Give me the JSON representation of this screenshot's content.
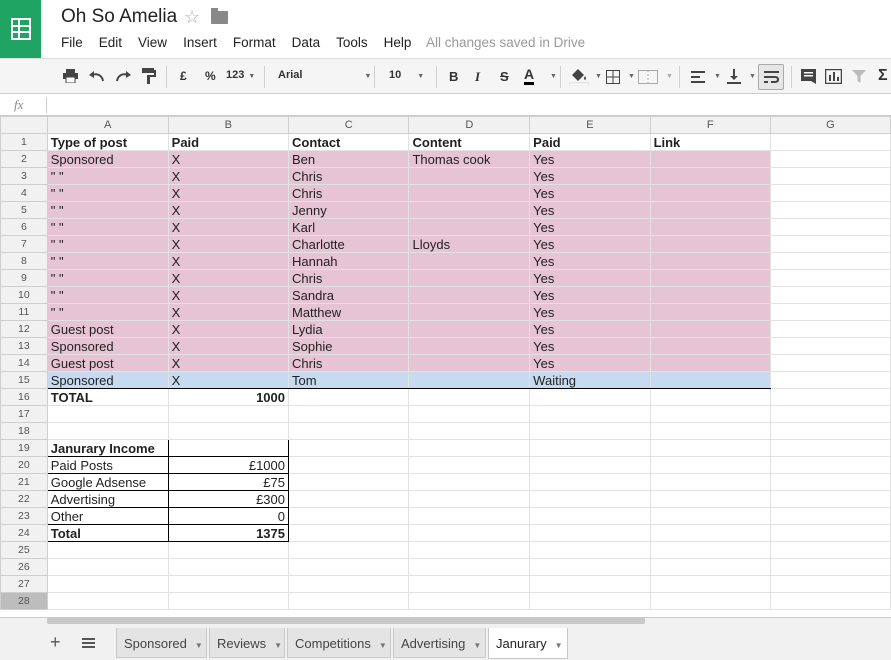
{
  "app": {
    "title": "Oh So Amelia",
    "saved_status": "All changes saved in Drive"
  },
  "menu": [
    "File",
    "Edit",
    "View",
    "Insert",
    "Format",
    "Data",
    "Tools",
    "Help"
  ],
  "toolbar": {
    "currency": "£",
    "percent": "%",
    "number_format": "123",
    "font": "Arial",
    "font_size": "10",
    "bold": "B",
    "italic": "I",
    "strike": "S",
    "text_color": "A"
  },
  "formula_bar": {
    "label": "fx",
    "value": ""
  },
  "columns": [
    "A",
    "B",
    "C",
    "D",
    "E",
    "F",
    "G"
  ],
  "rows": [
    {
      "n": "1",
      "cells": [
        "Type of post",
        "Paid",
        "Contact",
        "Content",
        "Paid",
        "Link"
      ],
      "style": "header"
    },
    {
      "n": "2",
      "cells": [
        "Sponsored",
        "X",
        "Ben",
        "Thomas cook",
        "Yes",
        ""
      ],
      "style": "pink"
    },
    {
      "n": "3",
      "cells": [
        "\" \"",
        "X",
        "Chris",
        "",
        "Yes",
        ""
      ],
      "style": "pink"
    },
    {
      "n": "4",
      "cells": [
        "\" \"",
        "X",
        "Chris",
        "",
        "Yes",
        ""
      ],
      "style": "pink"
    },
    {
      "n": "5",
      "cells": [
        "\" \"",
        "X",
        "Jenny",
        "",
        "Yes",
        ""
      ],
      "style": "pink"
    },
    {
      "n": "6",
      "cells": [
        "\" \"",
        "X",
        "Karl",
        "",
        "Yes",
        ""
      ],
      "style": "pink"
    },
    {
      "n": "7",
      "cells": [
        "\" \"",
        "X",
        "Charlotte",
        "Lloyds",
        "Yes",
        ""
      ],
      "style": "pink"
    },
    {
      "n": "8",
      "cells": [
        "\" \"",
        "X",
        "Hannah",
        "",
        "Yes",
        ""
      ],
      "style": "pink"
    },
    {
      "n": "9",
      "cells": [
        "\" \"",
        "X",
        "Chris",
        "",
        "Yes",
        ""
      ],
      "style": "pink"
    },
    {
      "n": "10",
      "cells": [
        "\" \"",
        "X",
        "Sandra",
        "",
        "Yes",
        ""
      ],
      "style": "pink"
    },
    {
      "n": "11",
      "cells": [
        "\" \"",
        "X",
        "Matthew",
        "",
        "Yes",
        ""
      ],
      "style": "pink"
    },
    {
      "n": "12",
      "cells": [
        "Guest post",
        "X",
        "Lydia",
        "",
        "Yes",
        ""
      ],
      "style": "pink"
    },
    {
      "n": "13",
      "cells": [
        "Sponsored",
        "X",
        "Sophie",
        "",
        "Yes",
        ""
      ],
      "style": "pink"
    },
    {
      "n": "14",
      "cells": [
        "Guest post",
        "X",
        "Chris",
        "",
        "Yes",
        ""
      ],
      "style": "pink"
    },
    {
      "n": "15",
      "cells": [
        "Sponsored",
        "X",
        "Tom",
        "",
        "Waiting",
        ""
      ],
      "style": "blue"
    },
    {
      "n": "16",
      "cells": [
        "TOTAL",
        "1000",
        "",
        "",
        "",
        ""
      ],
      "style": "total"
    }
  ],
  "empty_rows": [
    "17",
    "18",
    "25",
    "26",
    "27",
    "28"
  ],
  "income": {
    "title": "Janurary Income",
    "rows": [
      {
        "n": "20",
        "label": "Paid Posts",
        "value": "£1000"
      },
      {
        "n": "21",
        "label": "Google Adsense",
        "value": "£75"
      },
      {
        "n": "22",
        "label": "Advertising",
        "value": "£300"
      },
      {
        "n": "23",
        "label": "Other",
        "value": "0"
      },
      {
        "n": "24",
        "label": "Total",
        "value": "1375"
      }
    ],
    "title_row": "19"
  },
  "sheets": [
    "Sponsored",
    "Reviews",
    "Competitions",
    "Advertising",
    "Janurary"
  ],
  "active_sheet": "Janurary"
}
